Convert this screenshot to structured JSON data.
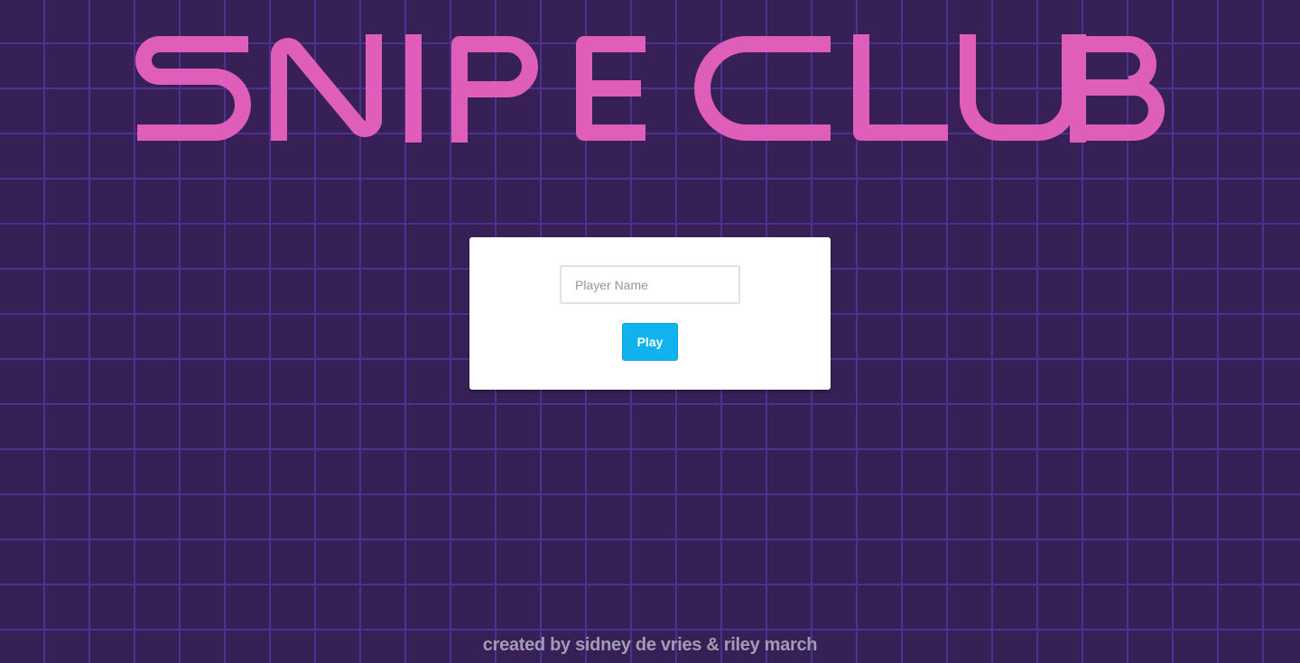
{
  "title": {
    "text": "SNIPE CLUB",
    "color": "#df5eb9"
  },
  "form": {
    "name_placeholder": "Player Name",
    "name_value": "",
    "play_label": "Play",
    "play_color": "#10b3ee"
  },
  "footer": {
    "credits": "created by sidney de vries & riley march"
  },
  "theme": {
    "background": "#362055",
    "grid_line": "#4b3290",
    "card": "#ffffff"
  }
}
